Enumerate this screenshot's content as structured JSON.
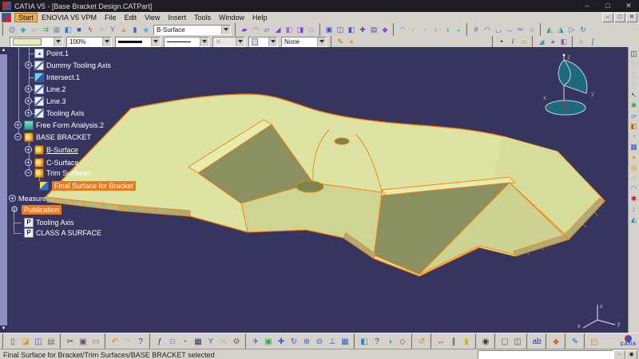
{
  "window": {
    "title": "CATIA V5 - [Base Bracket Design.CATPart]",
    "controls": {
      "minimize": "–",
      "maximize": "□",
      "close": "✕"
    }
  },
  "menu": {
    "items": [
      "Start",
      "ENOVIA V5 VPM",
      "File",
      "Edit",
      "View",
      "Insert",
      "Tools",
      "Window",
      "Help"
    ],
    "active": "Start",
    "mdi": {
      "minimize": "–",
      "restore": "□",
      "close": "✕"
    }
  },
  "toolbar_main": {
    "workbench": "B-Surface",
    "left_icons": [
      {
        "name": "spiral-curve-icon",
        "g": "@",
        "c": "#7a86a8"
      },
      {
        "name": "paint-pot-icon",
        "g": "◆",
        "c": "#3aa7cc"
      },
      {
        "name": "plane-cursor-icon",
        "g": "▱",
        "c": "#8a96b4"
      },
      {
        "name": "green-arrows-icon",
        "g": "⇉",
        "c": "#2fae4a"
      },
      {
        "name": "grid-icon",
        "g": "▦",
        "c": "#7d8cab"
      },
      {
        "name": "surface-patch-icon",
        "g": "◧",
        "c": "#3a72d4"
      },
      {
        "name": "solid-box-icon",
        "g": "■",
        "c": "#2a56c8"
      },
      {
        "name": "lightning-icon",
        "g": "ϟ",
        "c": "#d42222"
      },
      {
        "name": "gray-curves-icon",
        "g": "≈",
        "c": "#98a0b6"
      },
      {
        "name": "node-link-icon",
        "g": "Y",
        "c": "#4468cc"
      },
      {
        "name": "highlight-lamp-icon",
        "g": "▲",
        "c": "#e8a414"
      },
      {
        "name": "column-icon",
        "g": "▮",
        "c": "#3a66bb"
      },
      {
        "name": "diamond-surface-icon",
        "g": "◈",
        "c": "#36a8d8"
      }
    ],
    "surface_icons": [
      {
        "name": "extrude-surface-icon",
        "g": "▰",
        "c": "#8a3fd4"
      },
      {
        "name": "revolve-surface-icon",
        "g": "◠",
        "c": "#9a55e0"
      },
      {
        "name": "offset-surface-icon",
        "g": "▱",
        "c": "#7a30c0"
      },
      {
        "name": "sweep-surface-icon",
        "g": "◢",
        "c": "#8a3fd4"
      },
      {
        "name": "fill-surface-icon",
        "g": "◧",
        "c": "#a060e8"
      },
      {
        "name": "blend-surface-icon",
        "g": "◨",
        "c": "#8a3fd4"
      },
      {
        "name": "boundary-surface-icon",
        "g": "◇",
        "c": "#b070f0"
      }
    ],
    "operation_icons": [
      {
        "name": "split-icon",
        "g": "▣",
        "c": "#3a50cc"
      },
      {
        "name": "trim-icon",
        "g": "◫",
        "c": "#6a44bb"
      },
      {
        "name": "join-icon",
        "g": "◧",
        "c": "#2a5ad4"
      },
      {
        "name": "healing-icon",
        "g": "✚",
        "c": "#5a48c4"
      },
      {
        "name": "smooth-curve-icon",
        "g": "▤",
        "c": "#3a48aa"
      },
      {
        "name": "transform-icon",
        "g": "◆",
        "c": "#9a3fd0"
      }
    ],
    "analysis_icons": [
      {
        "name": "connect-checker-icon",
        "g": "◠",
        "c": "#1fb4c8"
      },
      {
        "name": "distance-analysis-icon",
        "g": "✓",
        "c": "#e8b81f"
      },
      {
        "name": "curvature-comb-icon",
        "g": "~",
        "c": "#1fc0e8"
      },
      {
        "name": "isophote-icon",
        "g": "◐",
        "c": "#e8a414"
      },
      {
        "name": "reflection-lines-icon",
        "g": "◑",
        "c": "#2fb89a"
      },
      {
        "name": "highlight-analysis-icon",
        "g": "◒",
        "c": "#3fa8e8"
      }
    ],
    "modify_icons": [
      {
        "name": "control-points-icon",
        "g": "#",
        "c": "#2a66cc"
      },
      {
        "name": "match-surface-icon",
        "g": "◠",
        "c": "#2a66cc"
      },
      {
        "name": "fit-surface-icon",
        "g": "◡",
        "c": "#2a66cc"
      },
      {
        "name": "extend-icon",
        "g": "↔",
        "c": "#2a66cc"
      },
      {
        "name": "break-icon",
        "g": "✂",
        "c": "#2a66cc"
      },
      {
        "name": "untrim-icon",
        "g": "○",
        "c": "#2a66cc"
      }
    ],
    "teal_icons": [
      {
        "name": "symmetry-icon",
        "g": "◭",
        "c": "#13899a"
      },
      {
        "name": "scaling-icon",
        "g": "◮",
        "c": "#13899a"
      },
      {
        "name": "translate-icon",
        "g": "▷",
        "c": "#13899a"
      },
      {
        "name": "rotate-shape-icon",
        "g": "↻",
        "c": "#13899a"
      }
    ]
  },
  "toolbar_props": {
    "fill_color": "#e9edb4",
    "opacity_value": "100%",
    "point_symbol": "✕",
    "render_value": "None",
    "paint_icons": [
      {
        "name": "copy-graphic-properties-icon",
        "g": "✎",
        "c": "#b06a1f"
      },
      {
        "name": "graphic-wizard-icon",
        "g": "●",
        "c": "#f09a22"
      }
    ],
    "wireframe_icons": [
      {
        "name": "point-icon",
        "g": "•",
        "c": "#223355"
      },
      {
        "name": "line-icon",
        "g": "/",
        "c": "#223355"
      },
      {
        "name": "plane-icon",
        "g": "▱",
        "c": "#c8a012"
      }
    ],
    "surface_wf_icons": [
      {
        "name": "extrude-icon",
        "g": "◢",
        "c": "#2f9ec4"
      },
      {
        "name": "sphere-icon",
        "g": "◕",
        "c": "#2f6fd4"
      },
      {
        "name": "cylinder-icon",
        "g": "◧",
        "c": "#8a55d4"
      }
    ],
    "curve_icons": [
      {
        "name": "circle-icon",
        "g": "○",
        "c": "#2a66cc"
      },
      {
        "name": "spline-icon",
        "g": "ʃ",
        "c": "#2a66cc"
      }
    ]
  },
  "tree": {
    "items": [
      {
        "label": "Point.1",
        "icon": "point"
      },
      {
        "label": "Dummy Tooling Axis",
        "icon": "line",
        "exp": "+"
      },
      {
        "label": "Intersect.1",
        "icon": "intersect"
      },
      {
        "label": "Line.2",
        "icon": "line",
        "exp": "+"
      },
      {
        "label": "Line.3",
        "icon": "line",
        "exp": "+"
      },
      {
        "label": "Tooling Axis",
        "icon": "line",
        "exp": "+"
      },
      {
        "label": "Free Form Analysis.2",
        "icon": "ffa",
        "exp": "+"
      },
      {
        "label": "BASE BRACKET",
        "icon": "body",
        "exp": "−"
      },
      {
        "label": "B-Surface",
        "icon": "body",
        "exp": "+"
      },
      {
        "label": "C-Surface",
        "icon": "body",
        "exp": "+"
      },
      {
        "label": "Trim Surfaces",
        "icon": "body",
        "exp": "−"
      },
      {
        "label": "Final Surface for Bracket",
        "icon": "surface"
      },
      {
        "label": "Measure",
        "exp": "+"
      },
      {
        "label": "Publication",
        "icon": "gear",
        "glyph": "⚙"
      },
      {
        "label": "Tooling Axis",
        "icon": "pub",
        "glyph": "P"
      },
      {
        "label": "CLASS A SURFACE",
        "icon": "pub",
        "glyph": "P"
      }
    ],
    "selected_item": "Final Surface for Bracket",
    "highlighted_items": [
      "Final Surface for Bracket",
      "Publication"
    ],
    "in_work_object": "B-Surface"
  },
  "viewport": {
    "compass": {
      "x": "x",
      "y": "y",
      "z": "z"
    },
    "triad": {
      "x": "x",
      "y": "y",
      "z": "z"
    },
    "scroll_up": "▲",
    "scroll_down": "▼"
  },
  "side_icons": [
    {
      "name": "plot-icon",
      "g": "◫",
      "c": "#333344"
    },
    {
      "name": "sheet-icon",
      "g": "▯",
      "c": "#999999",
      "d": true
    },
    {
      "name": "sheet-icon",
      "g": "▯",
      "c": "#999999",
      "d": true
    },
    {
      "name": "sheet-icon",
      "g": "▯",
      "c": "#999999",
      "d": true
    },
    {
      "name": "select-cursor-icon",
      "g": "↖",
      "c": "#2a56c8"
    },
    {
      "name": "run-simulation-icon",
      "g": "✱",
      "c": "#2fae4a"
    },
    {
      "name": "sketch-tracer-icon",
      "g": "▱",
      "c": "#2a66cc"
    },
    {
      "name": "apply-material-icon",
      "g": "◧",
      "c": "#c86a2a"
    },
    {
      "name": "browser-icon",
      "g": "◔",
      "c": "#1fb4c8"
    },
    {
      "name": "grid-icon",
      "g": "▦",
      "c": "#2a56c8"
    },
    {
      "name": "part-body-icon",
      "g": "●",
      "c": "#e8a414"
    },
    {
      "name": "geometrical-set-icon",
      "g": "◍",
      "c": "#e8a414"
    },
    {
      "name": "lock-icon",
      "g": "∩",
      "c": "#c8901a"
    },
    {
      "name": "analysis-curve-icon",
      "g": "◠",
      "c": "#2a86d8"
    },
    {
      "name": "constraint-star-icon",
      "g": "✱",
      "c": "#c82222"
    },
    {
      "name": "exchange-icon",
      "g": "↕",
      "c": "#2a86d8"
    },
    {
      "name": "freestyle-sail-icon",
      "g": "◭",
      "c": "#13899a"
    }
  ],
  "toolbar_bottom": {
    "file_icons": [
      {
        "name": "new-document-icon",
        "g": "▯",
        "c": "#555566"
      },
      {
        "name": "open-folder-icon",
        "g": "◪",
        "c": "#d8a021"
      },
      {
        "name": "save-icon",
        "g": "◫",
        "c": "#2a56c8"
      },
      {
        "name": "print-icon",
        "g": "▤",
        "c": "#68707a"
      }
    ],
    "edit_icons": [
      {
        "name": "cut-icon",
        "g": "✂",
        "c": "#444444"
      },
      {
        "name": "copy-icon",
        "g": "▣",
        "c": "#555566"
      },
      {
        "name": "paste-icon",
        "g": "▭",
        "c": "#9a6a2a"
      }
    ],
    "undo_icons": [
      {
        "name": "undo-icon",
        "g": "↶",
        "c": "#e87d12"
      },
      {
        "name": "redo-icon",
        "g": "↷",
        "c": "#999999",
        "d": true
      },
      {
        "name": "whats-this-icon",
        "g": "?",
        "c": "#2a3a8a"
      }
    ],
    "knowledge_icons": [
      {
        "name": "formula-fx-icon",
        "g": "ƒ",
        "c": "#1a3a9a"
      },
      {
        "name": "comment-bubble-icon",
        "g": "⊙",
        "c": "#5a8ad4"
      },
      {
        "name": "knowledge-dot-icon",
        "g": "•",
        "c": "#888888"
      },
      {
        "name": "design-table-icon",
        "g": "▦",
        "c": "#223a66"
      },
      {
        "name": "share-node-icon",
        "g": "Y",
        "c": "#3a66aa"
      },
      {
        "name": "lock-icon",
        "g": "∩",
        "c": "#b8901a"
      },
      {
        "name": "filter-gears-icon",
        "g": "⚙",
        "c": "#666677"
      }
    ],
    "view_icons": [
      {
        "name": "fly-mode-icon",
        "g": "✈",
        "c": "#2a66cc"
      },
      {
        "name": "fit-all-in-icon",
        "g": "▣",
        "c": "#2fae4a"
      },
      {
        "name": "pan-icon",
        "g": "✚",
        "c": "#2a66cc"
      },
      {
        "name": "rotate-view-icon",
        "g": "↻",
        "c": "#2a66cc"
      },
      {
        "name": "zoom-in-icon",
        "g": "⊕",
        "c": "#2a66cc"
      },
      {
        "name": "zoom-out-icon",
        "g": "⊖",
        "c": "#2a66cc"
      },
      {
        "name": "normal-view-icon",
        "g": "⊥",
        "c": "#2a66cc"
      },
      {
        "name": "quad-view-icon",
        "g": "▦",
        "c": "#2a66cc"
      }
    ],
    "view2_icons": [
      {
        "name": "iso-cube-icon",
        "g": "◧",
        "c": "#2a86d8"
      },
      {
        "name": "quick-help-icon",
        "g": "?",
        "c": "#444455"
      },
      {
        "name": "shaded-view-icon",
        "g": "◑",
        "c": "#2f9e8a"
      },
      {
        "name": "wireframe-view-icon",
        "g": "◇",
        "c": "#555566"
      }
    ],
    "rotate_icons": [
      {
        "name": "turntable-icon",
        "g": "↺",
        "c": "#c88812"
      }
    ],
    "measure_icons": [
      {
        "name": "ruler-icon",
        "g": "↔",
        "c": "#c82222"
      },
      {
        "name": "measure-between-icon",
        "g": "∥",
        "c": "#444444"
      },
      {
        "name": "measure-inertia-icon",
        "g": "▮",
        "c": "#d8b012"
      }
    ],
    "capture_icons": [
      {
        "name": "camera-icon",
        "g": "◉",
        "c": "#333333"
      }
    ],
    "window_icons": [
      {
        "name": "new-window-icon",
        "g": "▢",
        "c": "#555566"
      },
      {
        "name": "tile-window-icon",
        "g": "◫",
        "c": "#555566"
      }
    ],
    "tools_icons": [
      {
        "name": "spell-check-icon",
        "g": "ab",
        "c": "#1a3a9a"
      }
    ],
    "part_icons": [
      {
        "name": "product-part-icon",
        "g": "◆",
        "c": "#d86a2a"
      }
    ],
    "sketch_icons": [
      {
        "name": "sketcher-icon",
        "g": "✎",
        "c": "#2a66cc"
      }
    ],
    "catalog_icons": [
      {
        "name": "catalog-browser-icon",
        "g": "◰",
        "c": "#c8822a"
      }
    ]
  },
  "brand": {
    "name": "CATIA"
  },
  "statusbar": {
    "message": "Final Surface for Bracket/Trim Surfaces/BASE BRACKET selected"
  },
  "colors": {
    "viewport_bg": "#35355f",
    "part_fill": "#dde4a3",
    "part_edge_selected": "#f97e06",
    "tree_highlight": "#ea7a1f",
    "compass_teal": "#1d6a7a",
    "titlebar_bg": "#1d1d27"
  }
}
